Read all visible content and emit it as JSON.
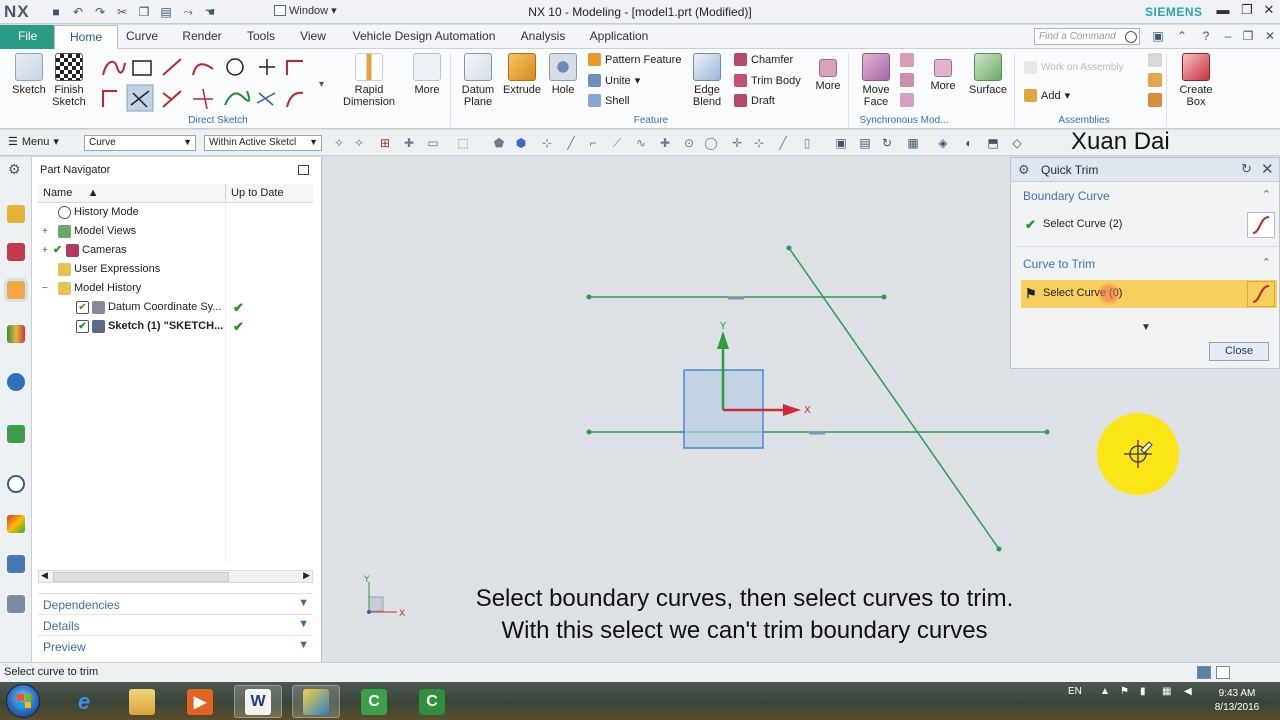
{
  "titlebar": {
    "logo": "NX",
    "window_menu": "Window",
    "title": "NX 10 - Modeling - [model1.prt (Modified)]",
    "brand": "SIEMENS",
    "brand_color": "#2aa7a8"
  },
  "tabs": {
    "file": "File",
    "items": [
      "Home",
      "Curve",
      "Render",
      "Tools",
      "View",
      "Vehicle Design Automation",
      "Analysis",
      "Application"
    ],
    "active": "Home",
    "find_placeholder": "Find a Command"
  },
  "ribbon": {
    "sketch": "Sketch",
    "finish_sketch_1": "Finish",
    "finish_sketch_2": "Sketch",
    "direct_sketch_label": "Direct Sketch",
    "rapid_1": "Rapid",
    "rapid_2": "Dimension",
    "more": "More",
    "datum_1": "Datum",
    "datum_2": "Plane",
    "extrude": "Extrude",
    "hole": "Hole",
    "pattern_feature": "Pattern Feature",
    "unite": "Unite",
    "shell": "Shell",
    "edge_1": "Edge",
    "edge_2": "Blend",
    "chamfer": "Chamfer",
    "trim_body": "Trim Body",
    "draft": "Draft",
    "feature_label": "Feature",
    "move_1": "Move",
    "move_2": "Face",
    "sync_label": "Synchronous Mod...",
    "surface": "Surface",
    "work_on_assembly": "Work on Assembly",
    "add": "Add",
    "assemblies_label": "Assemblies",
    "create_1": "Create",
    "create_2": "Box"
  },
  "selection_bar": {
    "menu": "Menu",
    "filter": "Curve",
    "scope": "Within Active Sketcl",
    "watermark": "Xuan Dai"
  },
  "navigator": {
    "title": "Part Navigator",
    "col_name": "Name",
    "col_uptodate": "Up to Date",
    "rows": [
      {
        "label": "History Mode",
        "expand": ""
      },
      {
        "label": "Model Views",
        "expand": "+"
      },
      {
        "label": "Cameras",
        "expand": "+"
      },
      {
        "label": "User Expressions",
        "expand": ""
      },
      {
        "label": "Model History",
        "expand": "−"
      },
      {
        "label": "Datum Coordinate Sy...",
        "expand": ""
      },
      {
        "label": "Sketch (1) \"SKETCH...",
        "expand": ""
      }
    ],
    "checkmark": "✔",
    "panels": [
      "Dependencies",
      "Details",
      "Preview"
    ]
  },
  "dialog": {
    "title": "Quick Trim",
    "boundary_section": "Boundary Curve",
    "boundary_select": "Select Curve (2)",
    "trim_section": "Curve to Trim",
    "trim_select": "Select Curve (0)",
    "close": "Close"
  },
  "graphics": {
    "axis_x": "X",
    "axis_y": "Y",
    "triad_x": "X",
    "triad_y": "Y",
    "curve_color": "#2f9b5a",
    "highlight_color": "#ffe600"
  },
  "captions": {
    "line1": "Select boundary curves, then select curves to trim.",
    "line2": "With this select we can't trim boundary curves"
  },
  "status": {
    "message": "Select curve to trim"
  },
  "taskbar": {
    "lang": "EN",
    "time": "9:43 AM",
    "date": "8/13/2016"
  }
}
